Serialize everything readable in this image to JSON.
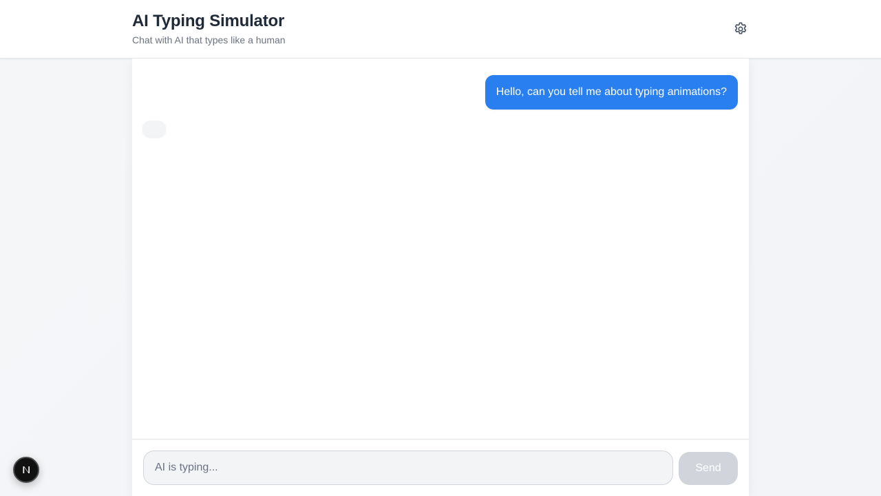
{
  "header": {
    "title": "AI Typing Simulator",
    "subtitle": "Chat with AI that types like a human",
    "settings_icon": "gear-icon"
  },
  "messages": [
    {
      "role": "user",
      "text": "Hello, can you tell me about typing animations?"
    },
    {
      "role": "assistant",
      "text": ""
    }
  ],
  "composer": {
    "placeholder": "AI is typing...",
    "value": "",
    "send_label": "Send"
  },
  "devtools": {
    "icon": "nextjs-logo-icon"
  },
  "colors": {
    "accent": "#2a7ff0",
    "user_bubble_text": "#ffffff",
    "ai_bubble": "#f3f4f6",
    "send_disabled": "#d1d5db",
    "title_text": "#1f2937",
    "muted_text": "#6b7280"
  }
}
